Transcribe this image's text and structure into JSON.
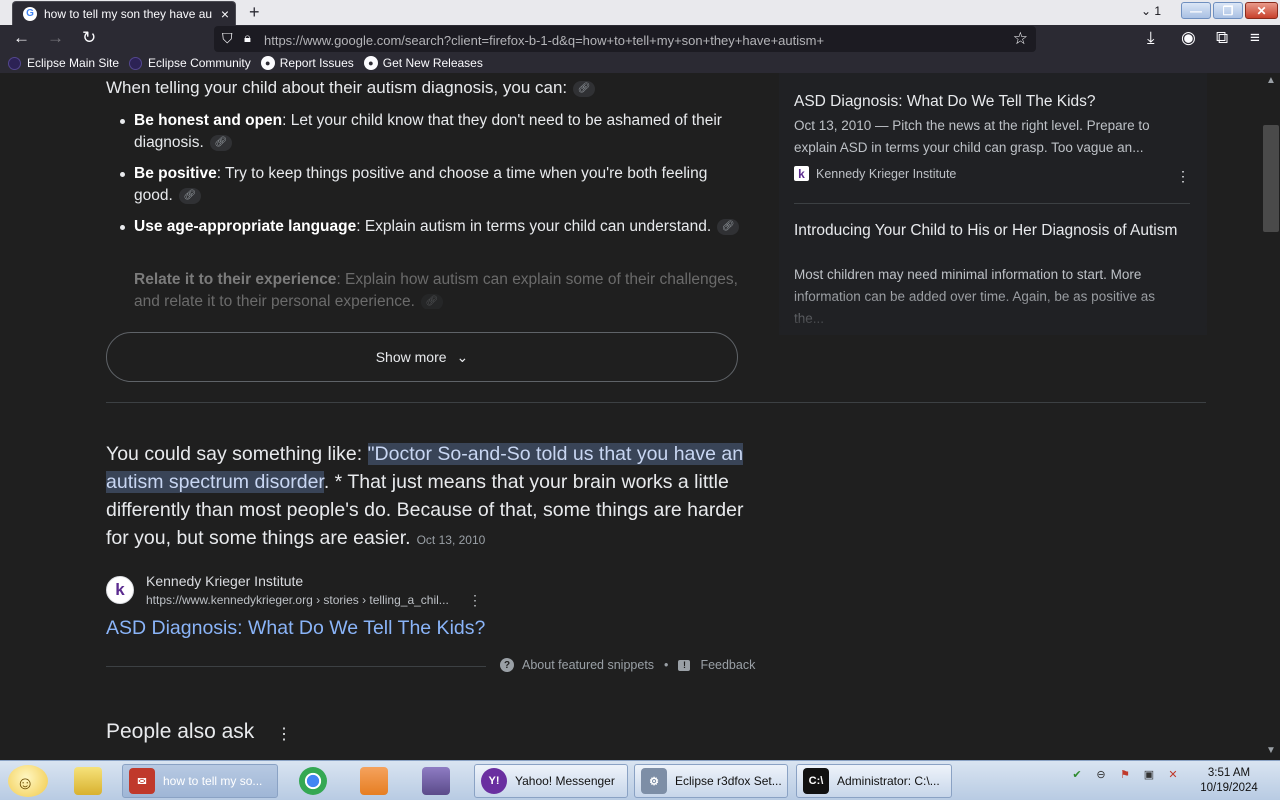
{
  "browser": {
    "tab_title": "how to tell my son they have au",
    "tab_close": "×",
    "new_tab": "+",
    "tab_count": "1",
    "url": "https://www.google.com/search?client=firefox-b-1-d&q=how+to+tell+my+son+they+have+autism+",
    "bookmarks": [
      "Eclipse Main Site",
      "Eclipse Community",
      "Report Issues",
      "Get New Releases"
    ]
  },
  "serp": {
    "intro": "When telling your child about their autism diagnosis, you can:",
    "bullets": [
      {
        "bold": "Be honest and open",
        "text": ": Let your child know that they don't need to be ashamed of their diagnosis."
      },
      {
        "bold": "Be positive",
        "text": ": Try to keep things positive and choose a time when you're both feeling good."
      },
      {
        "bold": "Use age-appropriate language",
        "text": ": Explain autism in terms your child can understand."
      },
      {
        "bold": "Relate it to their experience",
        "text": ": Explain how autism can explain some of their challenges, and relate it to their personal experience."
      }
    ],
    "show_more": "Show more",
    "right_panel": {
      "items": [
        {
          "title": "ASD Diagnosis: What Do We Tell The Kids?",
          "snippet": "Oct 13, 2010 — Pitch the news at the right level. Prepare to explain ASD in terms your child can grasp. Too vague an...",
          "source": "Kennedy Krieger Institute"
        },
        {
          "title": "Introducing Your Child to His or Her Diagnosis of Autism",
          "snippet": "Most children may need minimal information to start. More information can be added over time. Again, be as positive as the..."
        }
      ]
    },
    "answer": {
      "lead": "You could say something like: ",
      "highlight": "\"Doctor So-and-So told us that you have an autism spectrum disorder",
      "rest": ". * That just means that your brain works a little differently than most people's do. Because of that, some things are harder for you, but some things are easier.",
      "date": "Oct 13, 2010"
    },
    "source": {
      "name": "Kennedy Krieger Institute",
      "url": "https://www.kennedykrieger.org › stories › telling_a_chil...",
      "link_title": "ASD Diagnosis: What Do We Tell The Kids?"
    },
    "about_snippets": "About featured snippets",
    "separator": "•",
    "feedback": "Feedback",
    "people_also_ask": "People also ask"
  },
  "taskbar": {
    "buttons": [
      "how to tell my so...",
      "Yahoo! Messenger",
      "Eclipse r3dfox Set...",
      "Administrator: C:\\..."
    ],
    "time": "3:51 AM",
    "date": "10/19/2024"
  },
  "colors": {
    "accent_link": "#8ab4f8",
    "highlight_bg": "#394457",
    "page_bg": "#1f1f1f"
  }
}
